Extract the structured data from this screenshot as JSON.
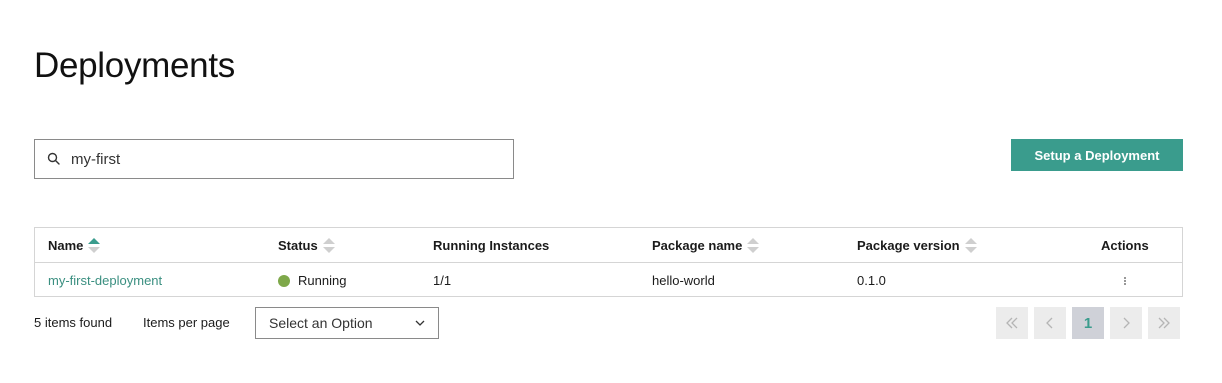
{
  "page": {
    "title": "Deployments"
  },
  "search": {
    "value": "my-first",
    "icon": "search-icon"
  },
  "toolbar": {
    "setup_label": "Setup a Deployment",
    "accent": "#3a9c8d"
  },
  "table": {
    "headers": {
      "name": "Name",
      "status": "Status",
      "running_instances": "Running Instances",
      "package_name": "Package name",
      "package_version": "Package version",
      "actions": "Actions"
    },
    "sort": {
      "active_column": "name",
      "direction": "ascending"
    },
    "rows": [
      {
        "name": "my-first-deployment",
        "status": "Running",
        "status_color": "#7ea84a",
        "running_instances": "1/1",
        "package_name": "hello-world",
        "package_version": "0.1.0"
      }
    ]
  },
  "footer": {
    "items_found": "5 items found",
    "items_per_page_label": "Items per page",
    "select_placeholder": "Select an Option",
    "pagination": {
      "current_page": "1"
    }
  }
}
